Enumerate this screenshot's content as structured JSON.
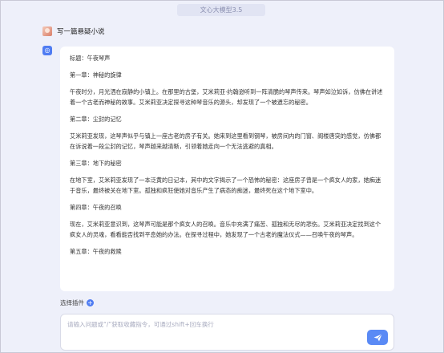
{
  "header": {
    "model_name": "文心大模型3.5"
  },
  "conversation": {
    "user_message": "写一篇悬疑小说",
    "bot_avatar_glyph": "◎",
    "reply": {
      "title": "标题：午夜琴声",
      "chapter1_heading": "第一章：神秘的旋律",
      "chapter1_text": "午夜时分，月光洒在寂静的小镇上。在那里的古堡，艾米莉亚·约翰逊听到一阵清脆的琴声传来。琴声如泣如诉，仿佛在讲述着一个古老而神秘的故事。艾米莉亚决定探寻这种琴音乐的源头，却发现了一个被遗忘的秘密。",
      "chapter2_heading": "第二章：尘封的记忆",
      "chapter2_text": "艾米莉亚发现，这琴声似乎与镇上一座古老的房子有关。她来到这里看到钢琴，被房间内的门窗、阁楼唐突的感觉，仿佛都在诉说着一段尘封的记忆，琴声越来越清晰，引领着她走向一个无法逃避的真相。",
      "chapter3_heading": "第三章：地下的秘密",
      "chapter3_text": "在地下室，艾米莉亚发现了一本泛黄的日记本，其中的文字揭示了一个恐怖的秘密：这座房子曾是一个疯女人的家，她痴迷于音乐，最终被关在地下室。孤独和疯狂使她对音乐产生了病态的痴迷，最终死在这个地下室中。",
      "chapter4_heading": "第四章：午夜的召唤",
      "chapter4_text": "现在，艾米莉亚意识到，这琴声可能是那个疯女人的召唤。音乐中充满了痛苦、孤独和无尽的悲伤。艾米莉亚决定找到这个疯女人的灵魂，看看能否找到平息她的办法。在探寻过程中，她发现了一个古老的魔法仪式——召唤午夜的琴声。",
      "chapter5_heading": "第五章：午夜的救赎"
    }
  },
  "plugin_button": {
    "label": "选择插件"
  },
  "input": {
    "placeholder": "请输入问题或“/”获取收藏指令，可通过shift+回车换行"
  },
  "colors": {
    "accent": "#4f7cf2",
    "background": "#eef0fa"
  }
}
